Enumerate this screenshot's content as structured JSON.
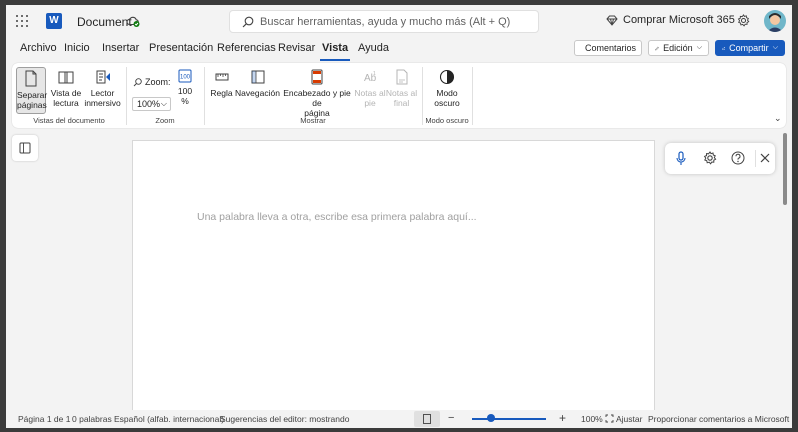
{
  "titlebar": {
    "doc_title": "Document",
    "search_placeholder": "Buscar herramientas, ayuda y mucho más (Alt + Q)",
    "buy_label": "Comprar Microsoft 365",
    "app_logo": "W"
  },
  "menu": {
    "tabs": [
      "Archivo",
      "Inicio",
      "Insertar",
      "Presentación",
      "Referencias",
      "Revisar",
      "Vista",
      "Ayuda"
    ],
    "active_tab": "Vista",
    "comments_label": "Comentarios",
    "editing_label": "Edición",
    "share_label": "Compartir"
  },
  "ribbon": {
    "groups": {
      "document_views": "Vistas del documento",
      "zoom": "Zoom",
      "show": "Mostrar",
      "dark_mode": "Modo oscuro"
    },
    "buttons": {
      "page_breaks": [
        "Separar",
        "páginas"
      ],
      "reading_view": [
        "Vista de",
        "lectura"
      ],
      "immersive_reader": [
        "Lector",
        "inmersivo"
      ],
      "zoom_label": "Zoom:",
      "zoom_value": "100%",
      "zoom_100": [
        "100",
        "%"
      ],
      "ruler": "Regla",
      "navigation": "Navegación",
      "header_footer": [
        "Encabezado y pie de",
        "página"
      ],
      "footnotes": [
        "Notas al",
        "pie"
      ],
      "endnotes": [
        "Notas al",
        "final"
      ],
      "dark_mode": [
        "Modo",
        "oscuro"
      ]
    }
  },
  "document": {
    "placeholder": "Una palabra lleva a otra, escribe esa primera palabra aquí..."
  },
  "statusbar": {
    "page": "Página 1 de 1",
    "words": "0 palabras",
    "language": "Español (alfab. internacional)",
    "editor": "Sugerencias del editor: mostrando",
    "zoom": "100%",
    "fit": "Ajustar",
    "feedback": "Proporcionar comentarios a Microsoft",
    "zoom_level": 0.25
  },
  "colors": {
    "accent": "#185abd",
    "frame": "#3b3b3b",
    "chrome": "#f3f3f3"
  }
}
